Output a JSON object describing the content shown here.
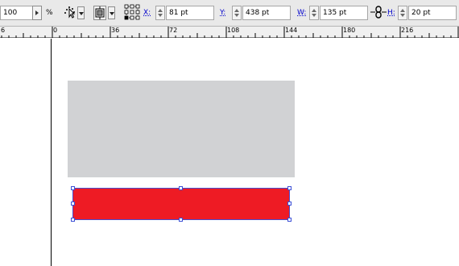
{
  "control_bar": {
    "scale_value": "100",
    "scale_unit": "%",
    "x_label": "X:",
    "x_value": "81 pt",
    "y_label": "Y:",
    "y_value": "438 pt",
    "w_label": "W:",
    "w_value": "135 pt",
    "h_label": "H:",
    "h_value": "20 pt"
  },
  "ruler": {
    "labels": [
      "6",
      "0",
      "36",
      "72",
      "108",
      "144",
      "180",
      "216"
    ]
  },
  "colors": {
    "red_fill": "#ee1b24",
    "gray_fill": "#d1d2d4",
    "selection": "#3b4fd6"
  },
  "icons": {
    "selection_tool": "direct-selection-icon",
    "align_stroke": "stroke-align-icon",
    "reference_point": "reference-point-grid-icon",
    "constrain": "chain-link-icon"
  }
}
